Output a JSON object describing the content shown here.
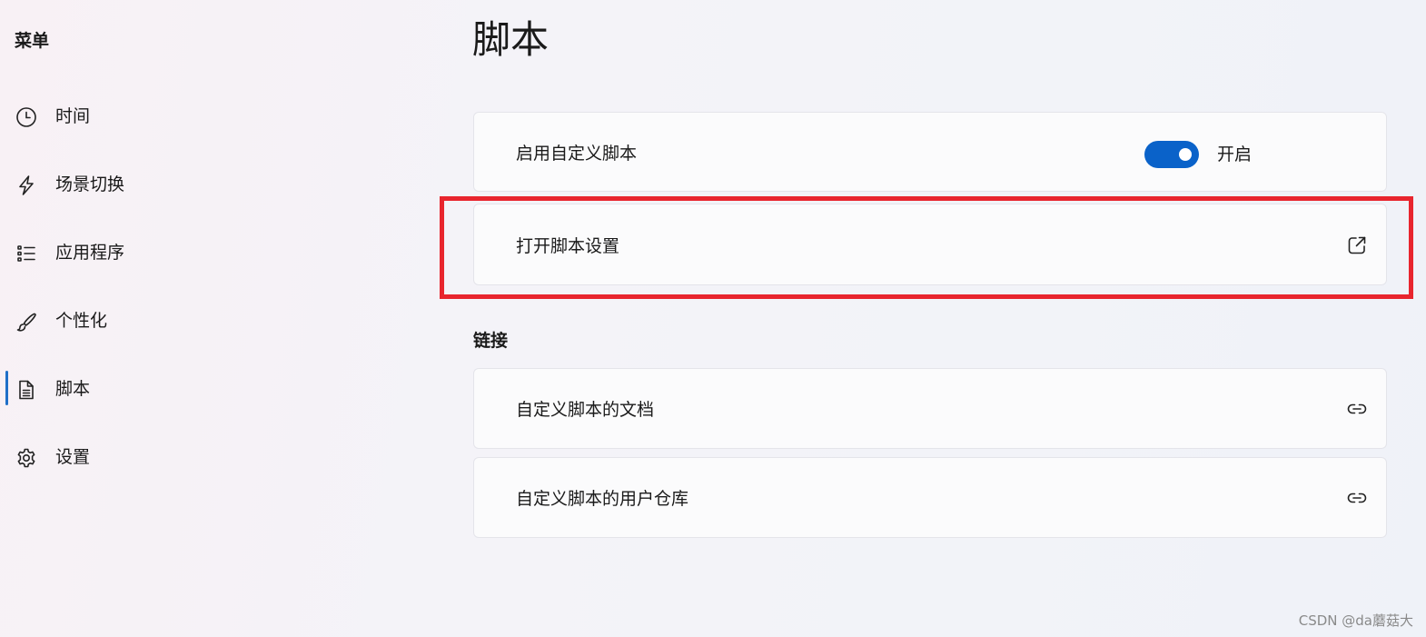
{
  "sidebar": {
    "title": "菜单",
    "items": [
      {
        "label": "时间",
        "icon": "clock-icon",
        "active": false
      },
      {
        "label": "场景切换",
        "icon": "lightning-icon",
        "active": false
      },
      {
        "label": "应用程序",
        "icon": "list-icon",
        "active": false
      },
      {
        "label": "个性化",
        "icon": "brush-icon",
        "active": false
      },
      {
        "label": "脚本",
        "icon": "document-icon",
        "active": true
      },
      {
        "label": "设置",
        "icon": "gear-icon",
        "active": false
      }
    ]
  },
  "main": {
    "title": "脚本",
    "enable_script": {
      "label": "启用自定义脚本",
      "state_label": "开启",
      "enabled": true
    },
    "open_settings": {
      "label": "打开脚本设置",
      "icon": "external-link-icon"
    },
    "links_section": {
      "title": "链接",
      "items": [
        {
          "label": "自定义脚本的文档",
          "icon": "link-icon"
        },
        {
          "label": "自定义脚本的用户仓库",
          "icon": "link-icon"
        }
      ]
    }
  },
  "colors": {
    "accent": "#0a62c9",
    "highlight": "#e8252e"
  },
  "watermark": "CSDN @da蘑菇大"
}
